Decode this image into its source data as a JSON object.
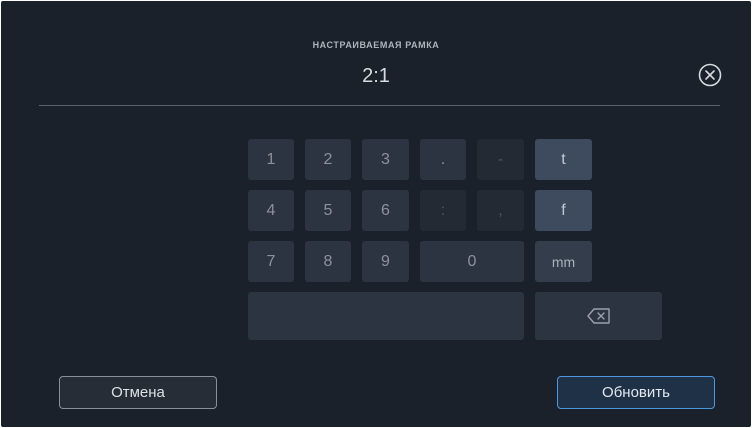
{
  "header": {
    "label": "НАСТРАИВАЕМАЯ РАМКА",
    "value": "2:1",
    "close_icon": "close-circle-icon"
  },
  "keypad": {
    "row1": [
      "1",
      "2",
      "3",
      ".",
      "-",
      "t"
    ],
    "row2": [
      "4",
      "5",
      "6",
      ":",
      ",",
      "f"
    ],
    "row3": [
      "7",
      "8",
      "9",
      "0",
      "mm"
    ],
    "space_key": "",
    "backspace_icon": "backspace-icon"
  },
  "actions": {
    "cancel_label": "Отмена",
    "update_label": "Обновить"
  },
  "colors": {
    "background": "#1b212a",
    "key": "#2c3442",
    "key_unit_active": "#3e4a5e",
    "accent": "#4d97dc"
  }
}
